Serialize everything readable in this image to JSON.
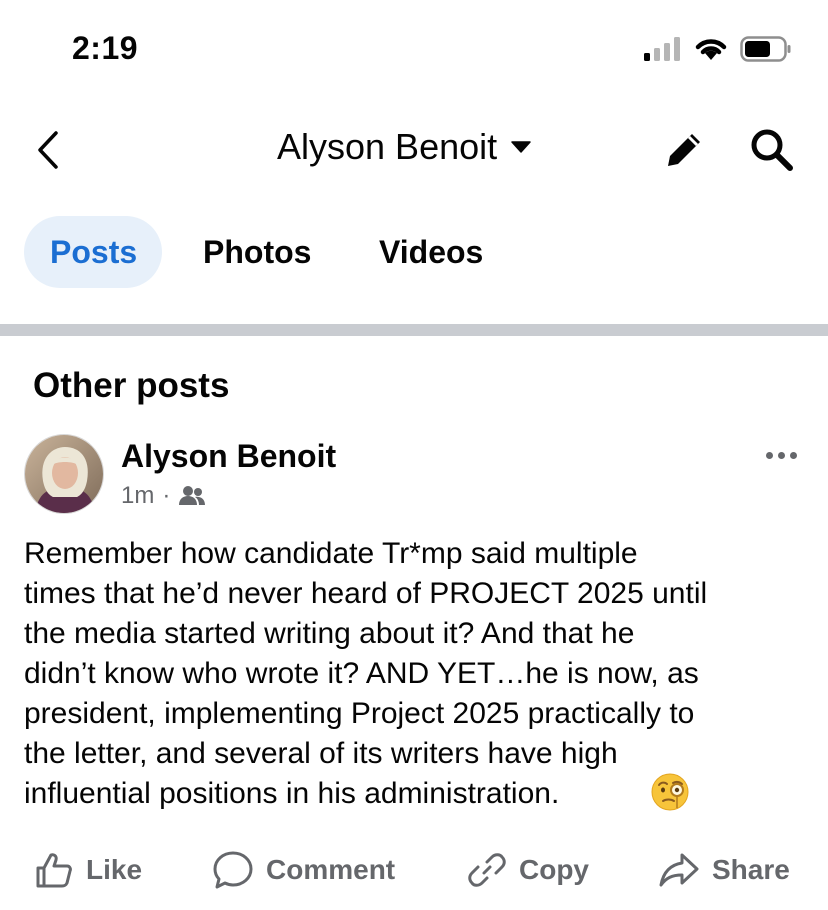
{
  "status_bar": {
    "time": "2:19"
  },
  "header": {
    "title": "Alyson Benoit"
  },
  "tabs": [
    {
      "label": "Posts"
    },
    {
      "label": "Photos"
    },
    {
      "label": "Videos"
    }
  ],
  "section": {
    "title": "Other posts"
  },
  "post": {
    "author": "Alyson Benoit",
    "time": "1m",
    "separator": "·",
    "text": "Remember how candidate Tr*mp said multiple\ntimes that he’d never heard of PROJECT 2025 until\nthe media started writing about it? And that he\ndidn’t know who wrote it? AND YET…he is now, as\npresident, implementing Project 2025 practically to\nthe letter, and several of its writers have high\ninfluential positions in his administration.",
    "emoji": "face-with-monocle",
    "audience_icon": "friends-icon"
  },
  "actions": [
    {
      "label": "Like",
      "icon": "thumbs-up-icon"
    },
    {
      "label": "Comment",
      "icon": "comment-icon"
    },
    {
      "label": "Copy",
      "icon": "link-icon"
    },
    {
      "label": "Share",
      "icon": "share-icon"
    }
  ],
  "colors": {
    "accent": "#1b6ed2",
    "accent_bg": "#e7f0fa",
    "secondary_text": "#65676b",
    "divider": "#c9ccd1"
  }
}
